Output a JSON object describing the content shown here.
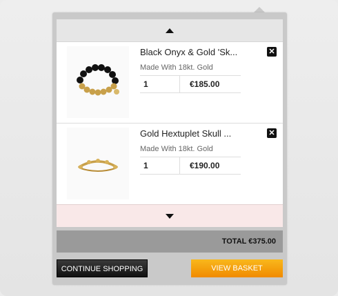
{
  "basket": {
    "items": [
      {
        "name": "Black Onyx & Gold 'Sk...",
        "subtitle": "Made With 18kt. Gold",
        "quantity": "1",
        "price": "€185.00",
        "image": "black-onyx-bead-bracelet"
      },
      {
        "name": "Gold Hextuplet Skull ...",
        "subtitle": "Made With 18kt. Gold",
        "quantity": "1",
        "price": "€190.00",
        "image": "gold-cuff-bracelet"
      }
    ],
    "remove_icon": "✕",
    "total_label": "TOTAL €375.00",
    "continue_label": "CONTINUE SHOPPING",
    "view_basket_label": "VIEW BASKET"
  },
  "icons": {
    "scroll_up": "triangle-up-icon",
    "scroll_down": "triangle-down-icon",
    "remove": "close-icon"
  },
  "colors": {
    "accent": "#f08a00",
    "dark_button": "#1a1a1a",
    "total_bar": "#9a9a9a"
  }
}
